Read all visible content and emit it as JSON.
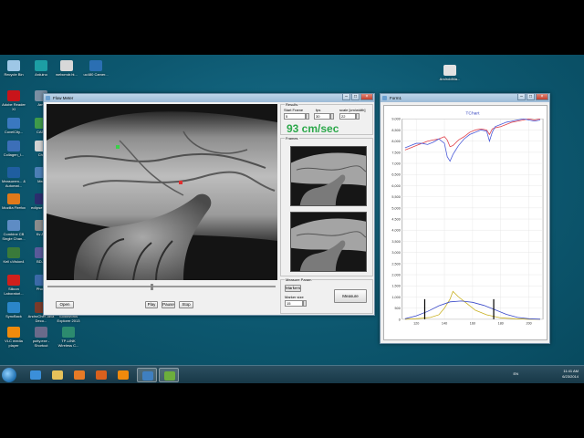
{
  "desktop_icons": [
    {
      "id": "recycle-bin",
      "label": "Recycle Bin",
      "color": "#9ec7e6"
    },
    {
      "id": "arduino",
      "label": "Arduino",
      "color": "#1d9ea4"
    },
    {
      "id": "webcmdr",
      "label": "webcmdr.ht...",
      "color": "#d8d8d8"
    },
    {
      "id": "uc480",
      "label": "uc480 Camer...",
      "color": "#2b6fb3"
    },
    {
      "id": "adobe-reader",
      "label": "Adobe Reader XI",
      "color": "#c8141a"
    },
    {
      "id": "arm",
      "label": "Arm",
      "color": "#7a8fa3"
    },
    {
      "id": "covelcity",
      "label": "CovelCity...",
      "color": "#3a78c0"
    },
    {
      "id": "ca53",
      "label": "CA53",
      "color": "#3f9a4a"
    },
    {
      "id": "collagen",
      "label": "Collagen_I...",
      "color": "#3c6fb8"
    },
    {
      "id": "chr",
      "label": "Chr",
      "color": "#d2d2d2"
    },
    {
      "id": "measurements",
      "label": "Measurem... & Automat...",
      "color": "#1f5ea0"
    },
    {
      "id": "mea",
      "label": "Mea",
      "color": "#4c7fb6"
    },
    {
      "id": "mozilla-firefox",
      "label": "Mozilla Firefox",
      "color": "#e0791a"
    },
    {
      "id": "eclipse",
      "label": "eclipse Shor",
      "color": "#2c2e6e"
    },
    {
      "id": "combine-cb",
      "label": "Combine CB Single Chan...",
      "color": "#5e8cc4"
    },
    {
      "id": "kv",
      "label": "Kv Ari",
      "color": "#8c8c8c"
    },
    {
      "id": "keil",
      "label": "Keil uVision4",
      "color": "#3a7a3a"
    },
    {
      "id": "bd-r",
      "label": "BD-R",
      "color": "#5a5a9a"
    },
    {
      "id": "silicon-labs",
      "label": "Silicon Laboratori...",
      "color": "#d0201c"
    },
    {
      "id": "photo",
      "label": "Photo",
      "color": "#3c6aa8"
    },
    {
      "id": "syncback",
      "label": "SyncBack",
      "color": "#2b86c9"
    },
    {
      "id": "androchef",
      "label": "AndroChef Java Deco...",
      "color": "#7a3b2a"
    },
    {
      "id": "solidworks",
      "label": "SolidWorks Explorer 2013",
      "color": "#c41f27"
    },
    {
      "id": "vlc",
      "label": "VLC media player",
      "color": "#f08a0c"
    },
    {
      "id": "putty",
      "label": "putty.exe - Shortcut",
      "color": "#6a6a8a"
    },
    {
      "id": "tp-link",
      "label": "TP-LINK Wireless C...",
      "color": "#2c8a6e"
    },
    {
      "id": "androidma",
      "label": "AndroidMa...",
      "color": "#e2e2e2"
    }
  ],
  "taskbar": {
    "apps": [
      {
        "id": "ie",
        "color": "#3b8fd9"
      },
      {
        "id": "explorer",
        "color": "#e7c15a"
      },
      {
        "id": "media",
        "color": "#e87a26"
      },
      {
        "id": "firefox",
        "color": "#d9601d"
      },
      {
        "id": "vlc",
        "color": "#f08a0c"
      },
      {
        "id": "app-active-1",
        "color": "#3f7fc0"
      },
      {
        "id": "app-active-2",
        "color": "#6cae3c"
      }
    ],
    "lang": "EN",
    "time": "11:41 AM",
    "date": "6/23/2014"
  },
  "flow_meter": {
    "title": "Flow Meter",
    "results": {
      "group_label": "Results",
      "start_frame_label": "Start Frame",
      "start_frame_value": "5",
      "fps_label": "fps",
      "fps_value": "30",
      "scale_label": "scale [cm/width]",
      "scale_value": "22",
      "speed": "93 cm/sec"
    },
    "frames_label": "Frames",
    "buttons": {
      "open": "Open",
      "play": "Play",
      "pause": "Pause",
      "stop": "Stop"
    },
    "measure_params": {
      "group_label": "Measure Param",
      "markers_button": "Markers",
      "marker_size_label": "Marker size",
      "marker_size_value": "15",
      "measure_button": "Measure"
    }
  },
  "form1": {
    "title": "Form1",
    "chart_data": {
      "type": "line",
      "title": "TChart",
      "ylim": [
        0,
        9000
      ],
      "y_ticks": [
        "0",
        "500",
        "1,000",
        "1,500",
        "2,000",
        "2,500",
        "3,000",
        "3,500",
        "4,000",
        "4,500",
        "5,000",
        "5,500",
        "6,000",
        "6,500",
        "7,000",
        "7,500",
        "8,000",
        "8,500",
        "9,000"
      ],
      "xlim": [
        110,
        210
      ],
      "x_ticks": [
        "120",
        "140",
        "160",
        "180",
        "200"
      ],
      "grid": true,
      "series": [
        {
          "color": "#e0404a",
          "x": [
            112,
            116,
            120,
            124,
            128,
            132,
            136,
            140,
            142,
            144,
            146,
            150,
            154,
            158,
            162,
            166,
            170,
            172,
            174,
            176,
            180,
            184,
            188,
            192,
            196,
            200,
            204,
            208
          ],
          "y": [
            7600,
            7700,
            7800,
            7900,
            8000,
            8050,
            8100,
            8200,
            8050,
            7750,
            7800,
            8050,
            8200,
            8400,
            8500,
            8550,
            8500,
            8300,
            8550,
            8600,
            8650,
            8750,
            8850,
            8900,
            8950,
            9000,
            8950,
            9000
          ]
        },
        {
          "color": "#4a5ad8",
          "x": [
            112,
            116,
            120,
            124,
            128,
            132,
            136,
            140,
            142,
            144,
            146,
            148,
            150,
            154,
            158,
            162,
            166,
            170,
            172,
            174,
            176,
            180,
            184,
            188,
            192,
            196,
            200,
            204,
            208
          ],
          "y": [
            7700,
            7800,
            7900,
            7900,
            7850,
            7950,
            8100,
            7900,
            7300,
            7100,
            7400,
            7600,
            7800,
            8100,
            8300,
            8400,
            8500,
            8450,
            8000,
            8400,
            8650,
            8750,
            8850,
            8900,
            8950,
            9000,
            8950,
            8900,
            8950
          ]
        },
        {
          "color": "#c8b020",
          "x": [
            112,
            120,
            130,
            136,
            140,
            144,
            146,
            150,
            156,
            162,
            170,
            180,
            190,
            200,
            208
          ],
          "y": [
            0,
            20,
            80,
            200,
            500,
            900,
            1250,
            1000,
            700,
            400,
            200,
            60,
            20,
            0,
            0
          ]
        },
        {
          "color": "#3848c8",
          "x": [
            112,
            120,
            128,
            136,
            144,
            152,
            160,
            168,
            176,
            184,
            192,
            200,
            208
          ],
          "y": [
            20,
            150,
            350,
            600,
            780,
            820,
            760,
            620,
            420,
            220,
            80,
            20,
            0
          ]
        }
      ],
      "markers_x": [
        126,
        175
      ]
    }
  }
}
